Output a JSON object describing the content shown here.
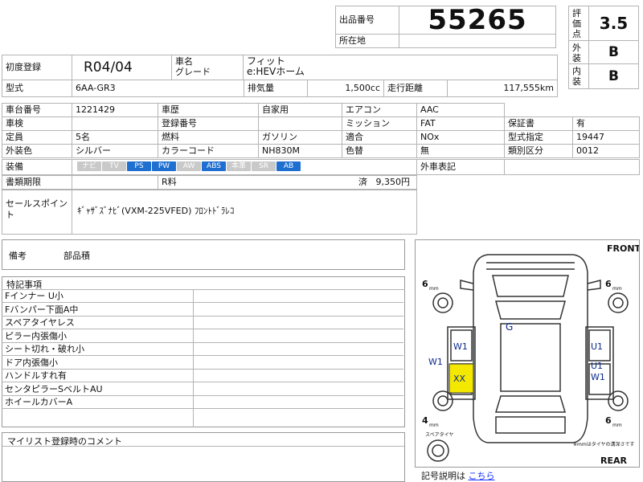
{
  "header": {
    "lot_label": "出品番号",
    "lot_number": "55265",
    "location_label": "所在地",
    "location_value": "",
    "score_label": "評価点",
    "score": "3.5",
    "exterior_label": "外装",
    "exterior_grade": "B",
    "interior_label": "内装",
    "interior_grade": "B"
  },
  "vehicle": {
    "first_reg_label": "初度登録",
    "first_reg": "R04/04",
    "name_label": "車名",
    "grade_label": "グレード",
    "name": "フィット",
    "grade": "e:HEVホーム",
    "model_label": "型式",
    "model": "6AA-GR3",
    "displacement_label": "排気量",
    "displacement": "1,500cc",
    "mileage_label": "走行距離",
    "mileage": "117,555km"
  },
  "specs": {
    "chassis_label": "車台番号",
    "chassis": "1221429",
    "history_label": "車歴",
    "history": "自家用",
    "ac_label": "エアコン",
    "ac": "AAC",
    "inspection_label": "車検",
    "inspection": "",
    "plate_label": "登録番号",
    "plate": "",
    "transmission_label": "ミッション",
    "transmission": "FAT",
    "warranty_label": "保証書",
    "warranty": "有",
    "capacity_label": "定員",
    "capacity": "5名",
    "fuel_label": "燃料",
    "fuel": "ガソリン",
    "compliance_label": "適合",
    "compliance": "NOx",
    "type_designation_label": "型式指定",
    "type_designation": "19447",
    "ext_color_label": "外装色",
    "ext_color": "シルバー",
    "color_code_label": "カラーコード",
    "color_code": "NH830M",
    "color_change_label": "色替",
    "color_change": "無",
    "class_label": "類別区分",
    "class_code": "0012",
    "equipment_label": "装備",
    "equipment": [
      {
        "label": "ナビ",
        "on": false
      },
      {
        "label": "TV",
        "on": false
      },
      {
        "label": "PS",
        "on": true
      },
      {
        "label": "PW",
        "on": true
      },
      {
        "label": "AW",
        "on": false
      },
      {
        "label": "ABS",
        "on": true
      },
      {
        "label": "本革",
        "on": false
      },
      {
        "label": "SR",
        "on": false
      },
      {
        "label": "AB",
        "on": true
      }
    ],
    "foreign_label": "外車表記",
    "docs_label": "書類期限",
    "recycle_label": "R料",
    "recycle_status": "済",
    "recycle_amount": "9,350円"
  },
  "sales_point": {
    "label": "セールスポイント",
    "text": "ｷﾞｬｻﾞｽﾞﾅﾋﾞ(VXM-225VFED) ﾌﾛﾝﾄﾄﾞﾗﾚｺ"
  },
  "remarks": {
    "label": "備考",
    "text": "部品積"
  },
  "special_notes": {
    "label": "特記事項",
    "items": [
      "Fインナー U小",
      "Fバンパー下面A中",
      "スペアタイヤレス",
      "ピラー内張傷小",
      "シート切れ・破れ小",
      "ドア内張傷小",
      "ハンドルすれ有",
      "センタピラーSベルトAU",
      "ホイールカバーA"
    ]
  },
  "comment": {
    "label": "マイリスト登録時のコメント",
    "text": ""
  },
  "diagram": {
    "front_label": "FRONT",
    "rear_label": "REAR",
    "spare_label": "スペアタイヤ",
    "tire_note": "※mmはタイヤの溝深さです",
    "tire_fl": "6",
    "tire_fr": "6",
    "tire_rl": "4",
    "tire_rr": "6",
    "tire_unit": "mm",
    "marks": {
      "roof": "G",
      "left_front_door": "W1",
      "left_side": "W1",
      "left_rear_door": "XX",
      "right_front_door": "U1",
      "right_rear_door_1": "U1",
      "right_rear_door_2": "W1"
    },
    "highlight_color": "#f4e800",
    "legend_label": "記号説明は",
    "legend_link": "こちら",
    "link_color": "#1a33ff"
  }
}
